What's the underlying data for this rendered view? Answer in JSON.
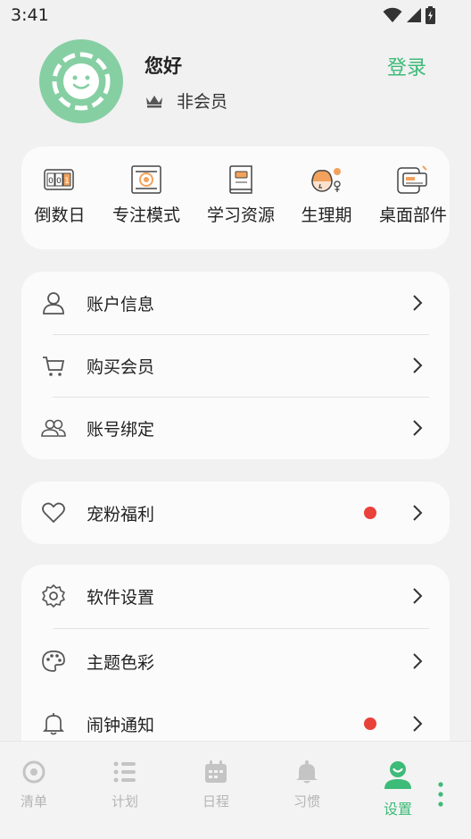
{
  "status_bar": {
    "time": "3:41",
    "icons": [
      "wifi-icon",
      "signal-icon",
      "battery-icon"
    ]
  },
  "profile": {
    "greeting": "您好",
    "membership": "非会员",
    "login_label": "登录",
    "avatar_color": "#86cfa3"
  },
  "quick_actions": [
    {
      "label": "倒数日",
      "icon": "countdown-icon"
    },
    {
      "label": "专注模式",
      "icon": "focus-hours-icon"
    },
    {
      "label": "学习资源",
      "icon": "book-icon"
    },
    {
      "label": "生理期",
      "icon": "period-icon"
    },
    {
      "label": "桌面部件",
      "icon": "widget-icon"
    }
  ],
  "account_section": [
    {
      "label": "账户信息",
      "icon": "person-icon"
    },
    {
      "label": "购买会员",
      "icon": "cart-icon"
    },
    {
      "label": "账号绑定",
      "icon": "people-icon"
    }
  ],
  "perks_section": [
    {
      "label": "宠粉福利",
      "icon": "heart-icon",
      "has_dot": true
    }
  ],
  "settings_section": [
    {
      "label": "软件设置",
      "icon": "gear-icon"
    },
    {
      "label": "主题色彩",
      "icon": "palette-icon"
    },
    {
      "label": "闹钟通知",
      "icon": "bell-icon",
      "has_dot": true
    }
  ],
  "bottom_nav": [
    {
      "label": "清单",
      "icon": "list-circle-icon",
      "active": false
    },
    {
      "label": "计划",
      "icon": "plan-list-icon",
      "active": false
    },
    {
      "label": "日程",
      "icon": "calendar-icon",
      "active": false
    },
    {
      "label": "习惯",
      "icon": "bell-habit-icon",
      "active": false
    },
    {
      "label": "设置",
      "icon": "user-settings-icon",
      "active": true
    }
  ],
  "colors": {
    "accent": "#3dbb78",
    "dot": "#e9423a",
    "background": "#f1f1f1",
    "card": "#fbfbfb"
  }
}
